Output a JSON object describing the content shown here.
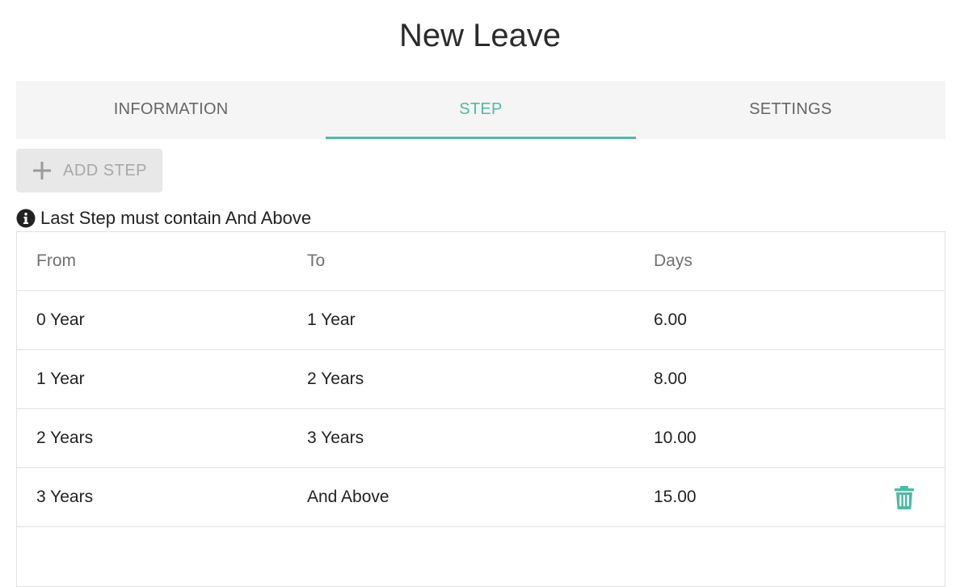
{
  "page": {
    "title": "New Leave"
  },
  "tabs": [
    {
      "label": "INFORMATION",
      "active": false
    },
    {
      "label": "STEP",
      "active": true
    },
    {
      "label": "SETTINGS",
      "active": false
    }
  ],
  "toolbar": {
    "add_step_label": "ADD STEP",
    "add_step_icon": "plus-icon"
  },
  "notice": {
    "icon": "info-circle-icon",
    "text": "Last Step must contain And Above"
  },
  "table": {
    "headers": {
      "from": "From",
      "to": "To",
      "days": "Days"
    },
    "rows": [
      {
        "from": "0 Year",
        "to": "1 Year",
        "days": "6.00"
      },
      {
        "from": "1 Year",
        "to": "2 Years",
        "days": "8.00"
      },
      {
        "from": "2 Years",
        "to": "3 Years",
        "days": "10.00"
      },
      {
        "from": "3 Years",
        "to": "And Above",
        "days": "15.00",
        "action_icon": "trash-icon"
      }
    ]
  },
  "colors": {
    "accent": "#4dbaa6",
    "tab_bg": "#f5f5f5",
    "button_disabled_bg": "#e8e8e8"
  }
}
